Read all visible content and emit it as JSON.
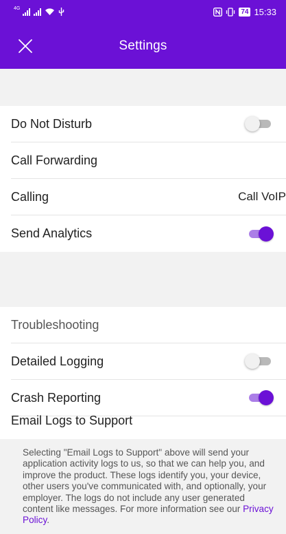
{
  "status_bar": {
    "left_tiny": "4G",
    "time": "15:33",
    "battery": "74",
    "nfc_label": "N"
  },
  "app_bar": {
    "title": "Settings",
    "close_icon": "close-icon"
  },
  "settings": {
    "do_not_disturb": {
      "label": "Do Not Disturb",
      "enabled": false
    },
    "call_forwarding": {
      "label": "Call Forwarding"
    },
    "calling": {
      "label": "Calling",
      "value": "Call VoIP"
    },
    "send_analytics": {
      "label": "Send Analytics",
      "enabled": true
    }
  },
  "troubleshooting": {
    "header": "Troubleshooting",
    "detailed_logging": {
      "label": "Detailed Logging",
      "enabled": false
    },
    "crash_reporting": {
      "label": "Crash Reporting",
      "enabled": true
    },
    "email_logs": {
      "label": "Email Logs to Support"
    }
  },
  "footer": {
    "text": "Selecting \"Email Logs to Support\" above will send your application activity logs to us, so that we can help you, and improve the product. These logs identify you, your device, other users you've communicated with, and optionally, your employer. The logs do not include any user generated content like messages. For more information see our ",
    "link": "Privacy Policy",
    "end": "."
  },
  "colors": {
    "brand": "#6b11d6",
    "toggle_on_track": "#ab7ee7",
    "section_background": "#f2f2f2"
  }
}
